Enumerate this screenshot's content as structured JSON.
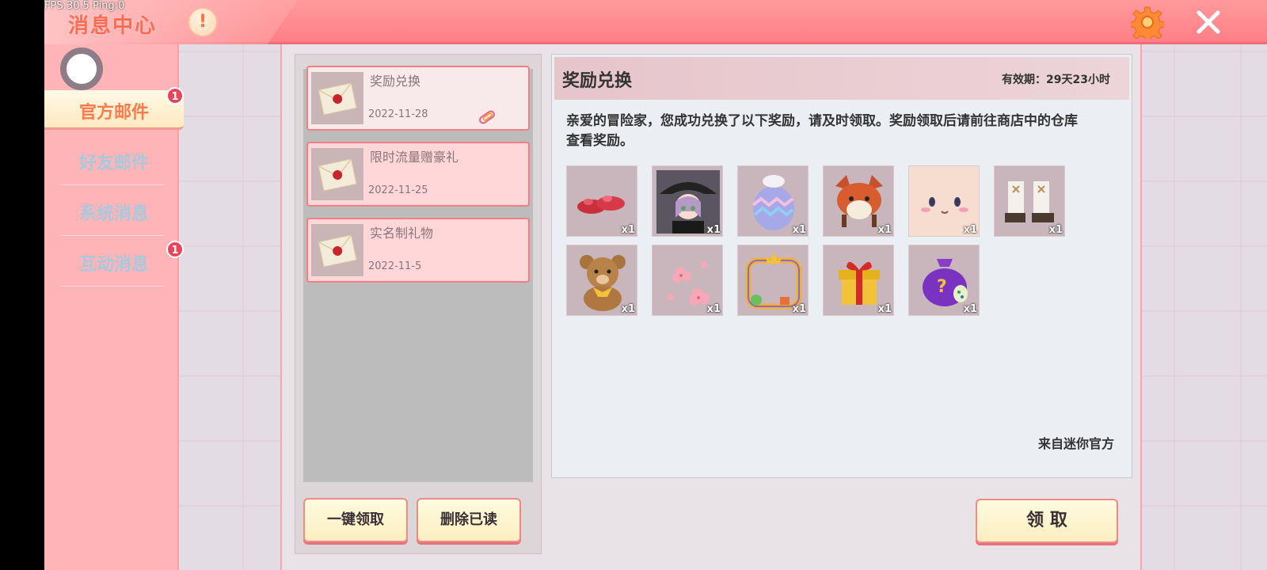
{
  "overlay": {
    "fps": "FPS:30.5  Ping:0"
  },
  "header": {
    "title": "消息中心",
    "notice_symbol": "!"
  },
  "sidebar": {
    "items": [
      {
        "label": "官方邮件",
        "badge": "1"
      },
      {
        "label": "好友邮件"
      },
      {
        "label": "系统消息"
      },
      {
        "label": "互动消息",
        "badge": "1"
      }
    ]
  },
  "mail_list": {
    "items": [
      {
        "title": "奖励兑换",
        "date": "2022-11-28"
      },
      {
        "title": "限时流量赠豪礼",
        "date": "2022-11-25"
      },
      {
        "title": "实名制礼物",
        "date": "2022-11-5"
      }
    ],
    "claim_all_label": "一键领取",
    "delete_read_label": "删除已读"
  },
  "detail": {
    "title": "奖励兑换",
    "validity": "有效期：29天23小时",
    "body": "亲爱的冒险家，您成功兑换了以下奖励，请及时领取。奖励领取后请前往商店中的仓库查看奖励。",
    "sender": "来自迷你官方",
    "claim_label": "领 取",
    "rewards": [
      {
        "icon": "red-shoes-icon",
        "qty": "x1"
      },
      {
        "icon": "witch-avatar-icon",
        "qty": "x1"
      },
      {
        "icon": "easter-egg-costume-icon",
        "qty": "x1"
      },
      {
        "icon": "fox-hat-icon",
        "qty": "x1"
      },
      {
        "icon": "face-skin-icon",
        "qty": "x1"
      },
      {
        "icon": "white-boots-icon",
        "qty": "x1"
      },
      {
        "icon": "teddy-bear-icon",
        "qty": "x1"
      },
      {
        "icon": "cherry-blossom-icon",
        "qty": "x1"
      },
      {
        "icon": "avatar-frame-icon",
        "qty": "x1"
      },
      {
        "icon": "gift-box-icon",
        "qty": "x1"
      },
      {
        "icon": "mystery-bag-icon",
        "qty": "x1"
      }
    ]
  }
}
